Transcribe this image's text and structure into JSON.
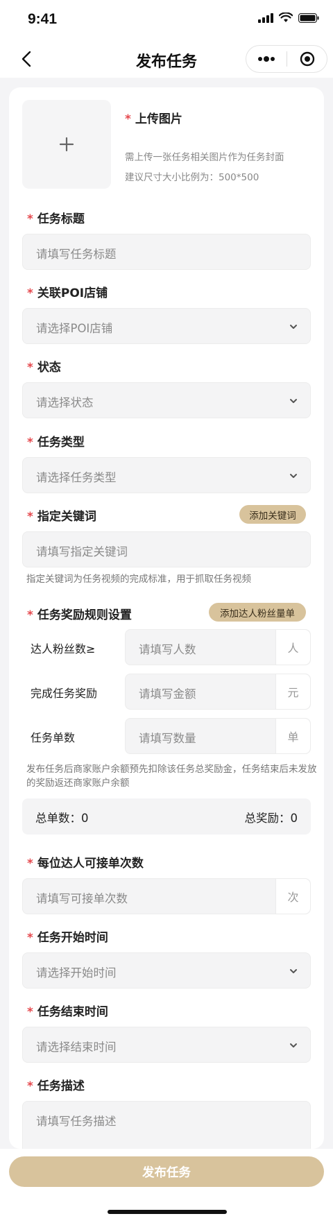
{
  "status_bar": {
    "time": "9:41"
  },
  "nav": {
    "title": "发布任务"
  },
  "upload": {
    "plus": "+",
    "title": "上传图片",
    "hint1": "需上传一张任务相关图片作为任务封面",
    "hint2": "建议尺寸大小比例为：500*500"
  },
  "required_mark": "*",
  "task_title": {
    "label": "任务标题",
    "placeholder": "请填写任务标题"
  },
  "poi": {
    "label": "关联POI店铺",
    "placeholder": "请选择POI店铺"
  },
  "status": {
    "label": "状态",
    "placeholder": "请选择状态"
  },
  "task_type": {
    "label": "任务类型",
    "placeholder": "请选择任务类型"
  },
  "keywords": {
    "label": "指定关键词",
    "add_button": "添加关键词",
    "placeholder": "请填写指定关键词",
    "helper": "指定关键词为任务视频的完成标准，用于抓取任务视频"
  },
  "reward_rules": {
    "label": "任务奖励规则设置",
    "add_button": "添加达人粉丝量单",
    "rows": [
      {
        "label": "达人粉丝数≥",
        "placeholder": "请填写人数",
        "unit": "人"
      },
      {
        "label": "完成任务奖励",
        "placeholder": "请填写金额",
        "unit": "元"
      },
      {
        "label": "任务单数",
        "placeholder": "请填写数量",
        "unit": "单"
      }
    ],
    "helper": "发布任务后商家账户余额预先扣除该任务总奖励金，任务结束后未发放的奖励返还商家账户余额",
    "summary_left": "总单数：0",
    "summary_right": "总奖励：0"
  },
  "per_talent": {
    "label": "每位达人可接单次数",
    "placeholder": "请填写可接单次数",
    "unit": "次"
  },
  "start_time": {
    "label": "任务开始时间",
    "placeholder": "请选择开始时间"
  },
  "end_time": {
    "label": "任务结束时间",
    "placeholder": "请选择结束时间"
  },
  "description": {
    "label": "任务描述",
    "placeholder": "请填写任务描述"
  },
  "submit": {
    "label": "发布任务"
  },
  "colors": {
    "accent": "#d8c39c",
    "required": "#e5484d"
  }
}
